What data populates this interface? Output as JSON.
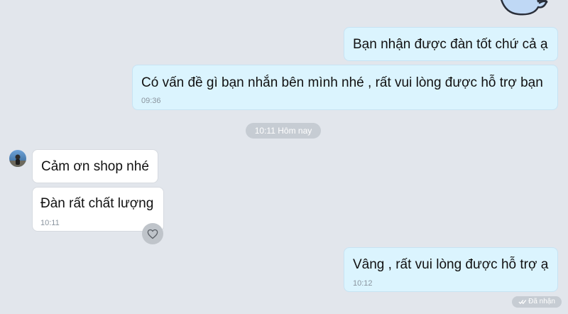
{
  "messages": [
    {
      "direction": "outgoing",
      "text": "Bạn nhận được đàn tốt chứ cả ạ"
    },
    {
      "direction": "outgoing",
      "text": "Có vấn đề gì bạn nhắn bên mình nhé , rất vui lòng được hỗ trợ bạn",
      "time": "09:36"
    },
    {
      "direction": "incoming",
      "text": "Cảm ơn shop nhé"
    },
    {
      "direction": "incoming",
      "text": "Đàn rất chất lượng",
      "time": "10:11"
    },
    {
      "direction": "outgoing",
      "text": "Vâng , rất vui lòng được hỗ trợ ạ",
      "time": "10:12"
    }
  ],
  "date_separator": "10:11 Hôm nay",
  "delivery_status": "Đã nhận",
  "icons": {
    "avatar": "user-avatar",
    "reaction": "heart-icon",
    "status": "double-check-icon",
    "sticker": "cat-sticker"
  },
  "colors": {
    "background": "#e2e6ec",
    "outgoing_bubble": "#dbf4fe",
    "incoming_bubble": "#ffffff",
    "pill": "#c6ccd3"
  }
}
